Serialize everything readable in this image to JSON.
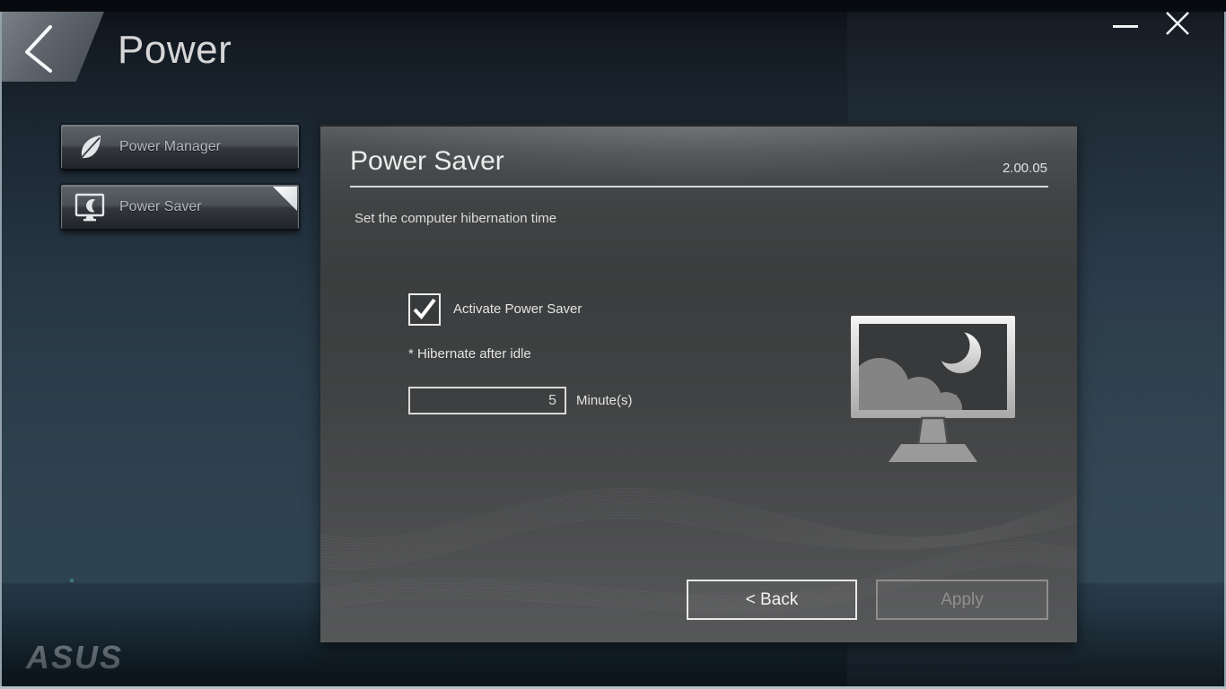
{
  "header": {
    "title": "Power"
  },
  "window_controls": {
    "minimize": "minimize",
    "close": "close"
  },
  "sidebar": {
    "items": [
      {
        "label": "Power Manager",
        "icon": "leaf-icon",
        "selected": false
      },
      {
        "label": "Power Saver",
        "icon": "monitor-moon-icon",
        "selected": true
      }
    ]
  },
  "panel": {
    "title": "Power Saver",
    "version": "2.00.05",
    "description": "Set the computer hibernation time",
    "activate_checkbox": {
      "label": "Activate Power Saver",
      "checked": true
    },
    "hibernate_label": "* Hibernate after idle",
    "minutes_value": "5",
    "minutes_unit": "Minute(s)",
    "back_label": "< Back",
    "apply_label": "Apply",
    "apply_enabled": false
  },
  "footer": {
    "brand": "ASUS"
  },
  "colors": {
    "panel_bg": "#3e4041",
    "backdrop_top": "#0a0e13",
    "backdrop_mid": "#2e4350",
    "frame_edge": "#93a1ab",
    "text_light": "#e4e4e4",
    "text_dim": "#909090"
  }
}
